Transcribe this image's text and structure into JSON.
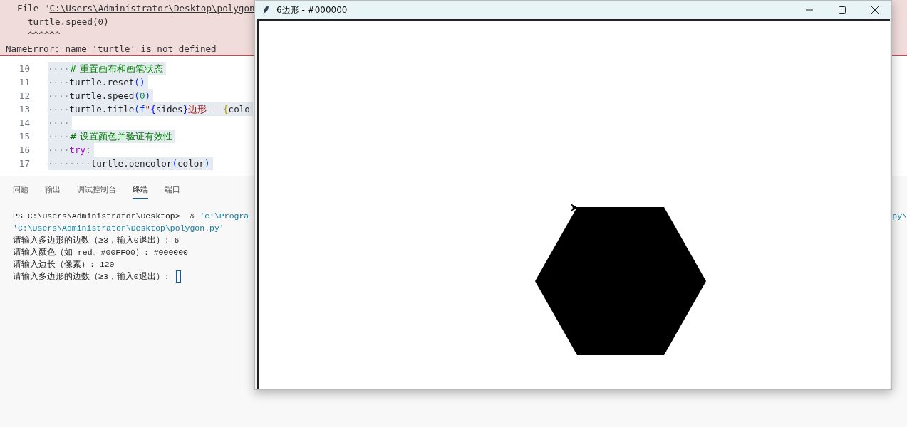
{
  "error_panel": {
    "file_prefix": "File \"",
    "file_link": "C:\\Users\\Administrator\\Desktop\\polygon",
    "code_lines": [
      "turtle.speed(0)",
      "^^^^^^"
    ],
    "message": "NameError: name 'turtle' is not defined"
  },
  "editor": {
    "lines": [
      {
        "number": "10",
        "tokens": [
          {
            "kind": "ws",
            "text": "····"
          },
          {
            "kind": "comment",
            "text": "# 重置画布和画笔状态"
          }
        ]
      },
      {
        "number": "11",
        "tokens": [
          {
            "kind": "ws",
            "text": "····"
          },
          {
            "kind": "plain",
            "text": "turtle.reset"
          },
          {
            "kind": "paren",
            "text": "()"
          }
        ]
      },
      {
        "number": "12",
        "tokens": [
          {
            "kind": "ws",
            "text": "····"
          },
          {
            "kind": "plain",
            "text": "turtle.speed"
          },
          {
            "kind": "paren",
            "text": "("
          },
          {
            "kind": "number",
            "text": "0"
          },
          {
            "kind": "paren",
            "text": ")"
          }
        ]
      },
      {
        "number": "13",
        "tokens": [
          {
            "kind": "ws",
            "text": "····"
          },
          {
            "kind": "plain",
            "text": "turtle.title"
          },
          {
            "kind": "paren",
            "text": "("
          },
          {
            "kind": "paren",
            "text": "f"
          },
          {
            "kind": "string",
            "text": "\""
          },
          {
            "kind": "brace",
            "text": "{"
          },
          {
            "kind": "plain",
            "text": "sides"
          },
          {
            "kind": "brace",
            "text": "}"
          },
          {
            "kind": "string",
            "text": "边形 - "
          },
          {
            "kind": "brace2",
            "text": "{"
          },
          {
            "kind": "plain",
            "text": "colo"
          }
        ]
      },
      {
        "number": "14",
        "tokens": [
          {
            "kind": "ws",
            "text": "····"
          }
        ]
      },
      {
        "number": "15",
        "tokens": [
          {
            "kind": "ws",
            "text": "····"
          },
          {
            "kind": "comment",
            "text": "# 设置颜色并验证有效性"
          }
        ]
      },
      {
        "number": "16",
        "tokens": [
          {
            "kind": "ws",
            "text": "····"
          },
          {
            "kind": "keyword",
            "text": "try"
          },
          {
            "kind": "plain",
            "text": ":"
          }
        ]
      },
      {
        "number": "17",
        "tokens": [
          {
            "kind": "ws",
            "text": "········"
          },
          {
            "kind": "plain",
            "text": "turtle.pencolor"
          },
          {
            "kind": "paren",
            "text": "("
          },
          {
            "kind": "plain",
            "text": "color"
          },
          {
            "kind": "paren",
            "text": ")"
          }
        ]
      }
    ]
  },
  "panel": {
    "tabs": [
      {
        "label": "问题",
        "selected": false
      },
      {
        "label": "输出",
        "selected": false
      },
      {
        "label": "调试控制台",
        "selected": false
      },
      {
        "label": "终端",
        "selected": true
      },
      {
        "label": "端口",
        "selected": false
      }
    ]
  },
  "terminal": {
    "lines": [
      {
        "parts": [
          {
            "kind": "plain",
            "text": "PS C:\\Users\\Administrator\\Desktop>  "
          },
          {
            "kind": "op",
            "text": "&"
          },
          {
            "kind": "string",
            "text": " 'c:\\Progra"
          }
        ],
        "right": "py\\",
        "cursor": false
      },
      {
        "parts": [
          {
            "kind": "string",
            "text": "'C:\\Users\\Administrator\\Desktop\\polygon.py'"
          }
        ],
        "cursor": false
      },
      {
        "parts": [
          {
            "kind": "plain",
            "text": "请输入多边形的边数（≥3，输入0退出）: 6"
          }
        ],
        "cursor": false
      },
      {
        "parts": [
          {
            "kind": "plain",
            "text": "请输入颜色（如 red、#00FF00）: #000000"
          }
        ],
        "cursor": false
      },
      {
        "parts": [
          {
            "kind": "plain",
            "text": "请输入边长（像素）: 120"
          }
        ],
        "cursor": false
      },
      {
        "parts": [
          {
            "kind": "plain",
            "text": "请输入多边形的边数（≥3，输入0退出）: "
          }
        ],
        "cursor": true
      }
    ]
  },
  "turtle_window": {
    "title": "6边形 - #000000"
  }
}
